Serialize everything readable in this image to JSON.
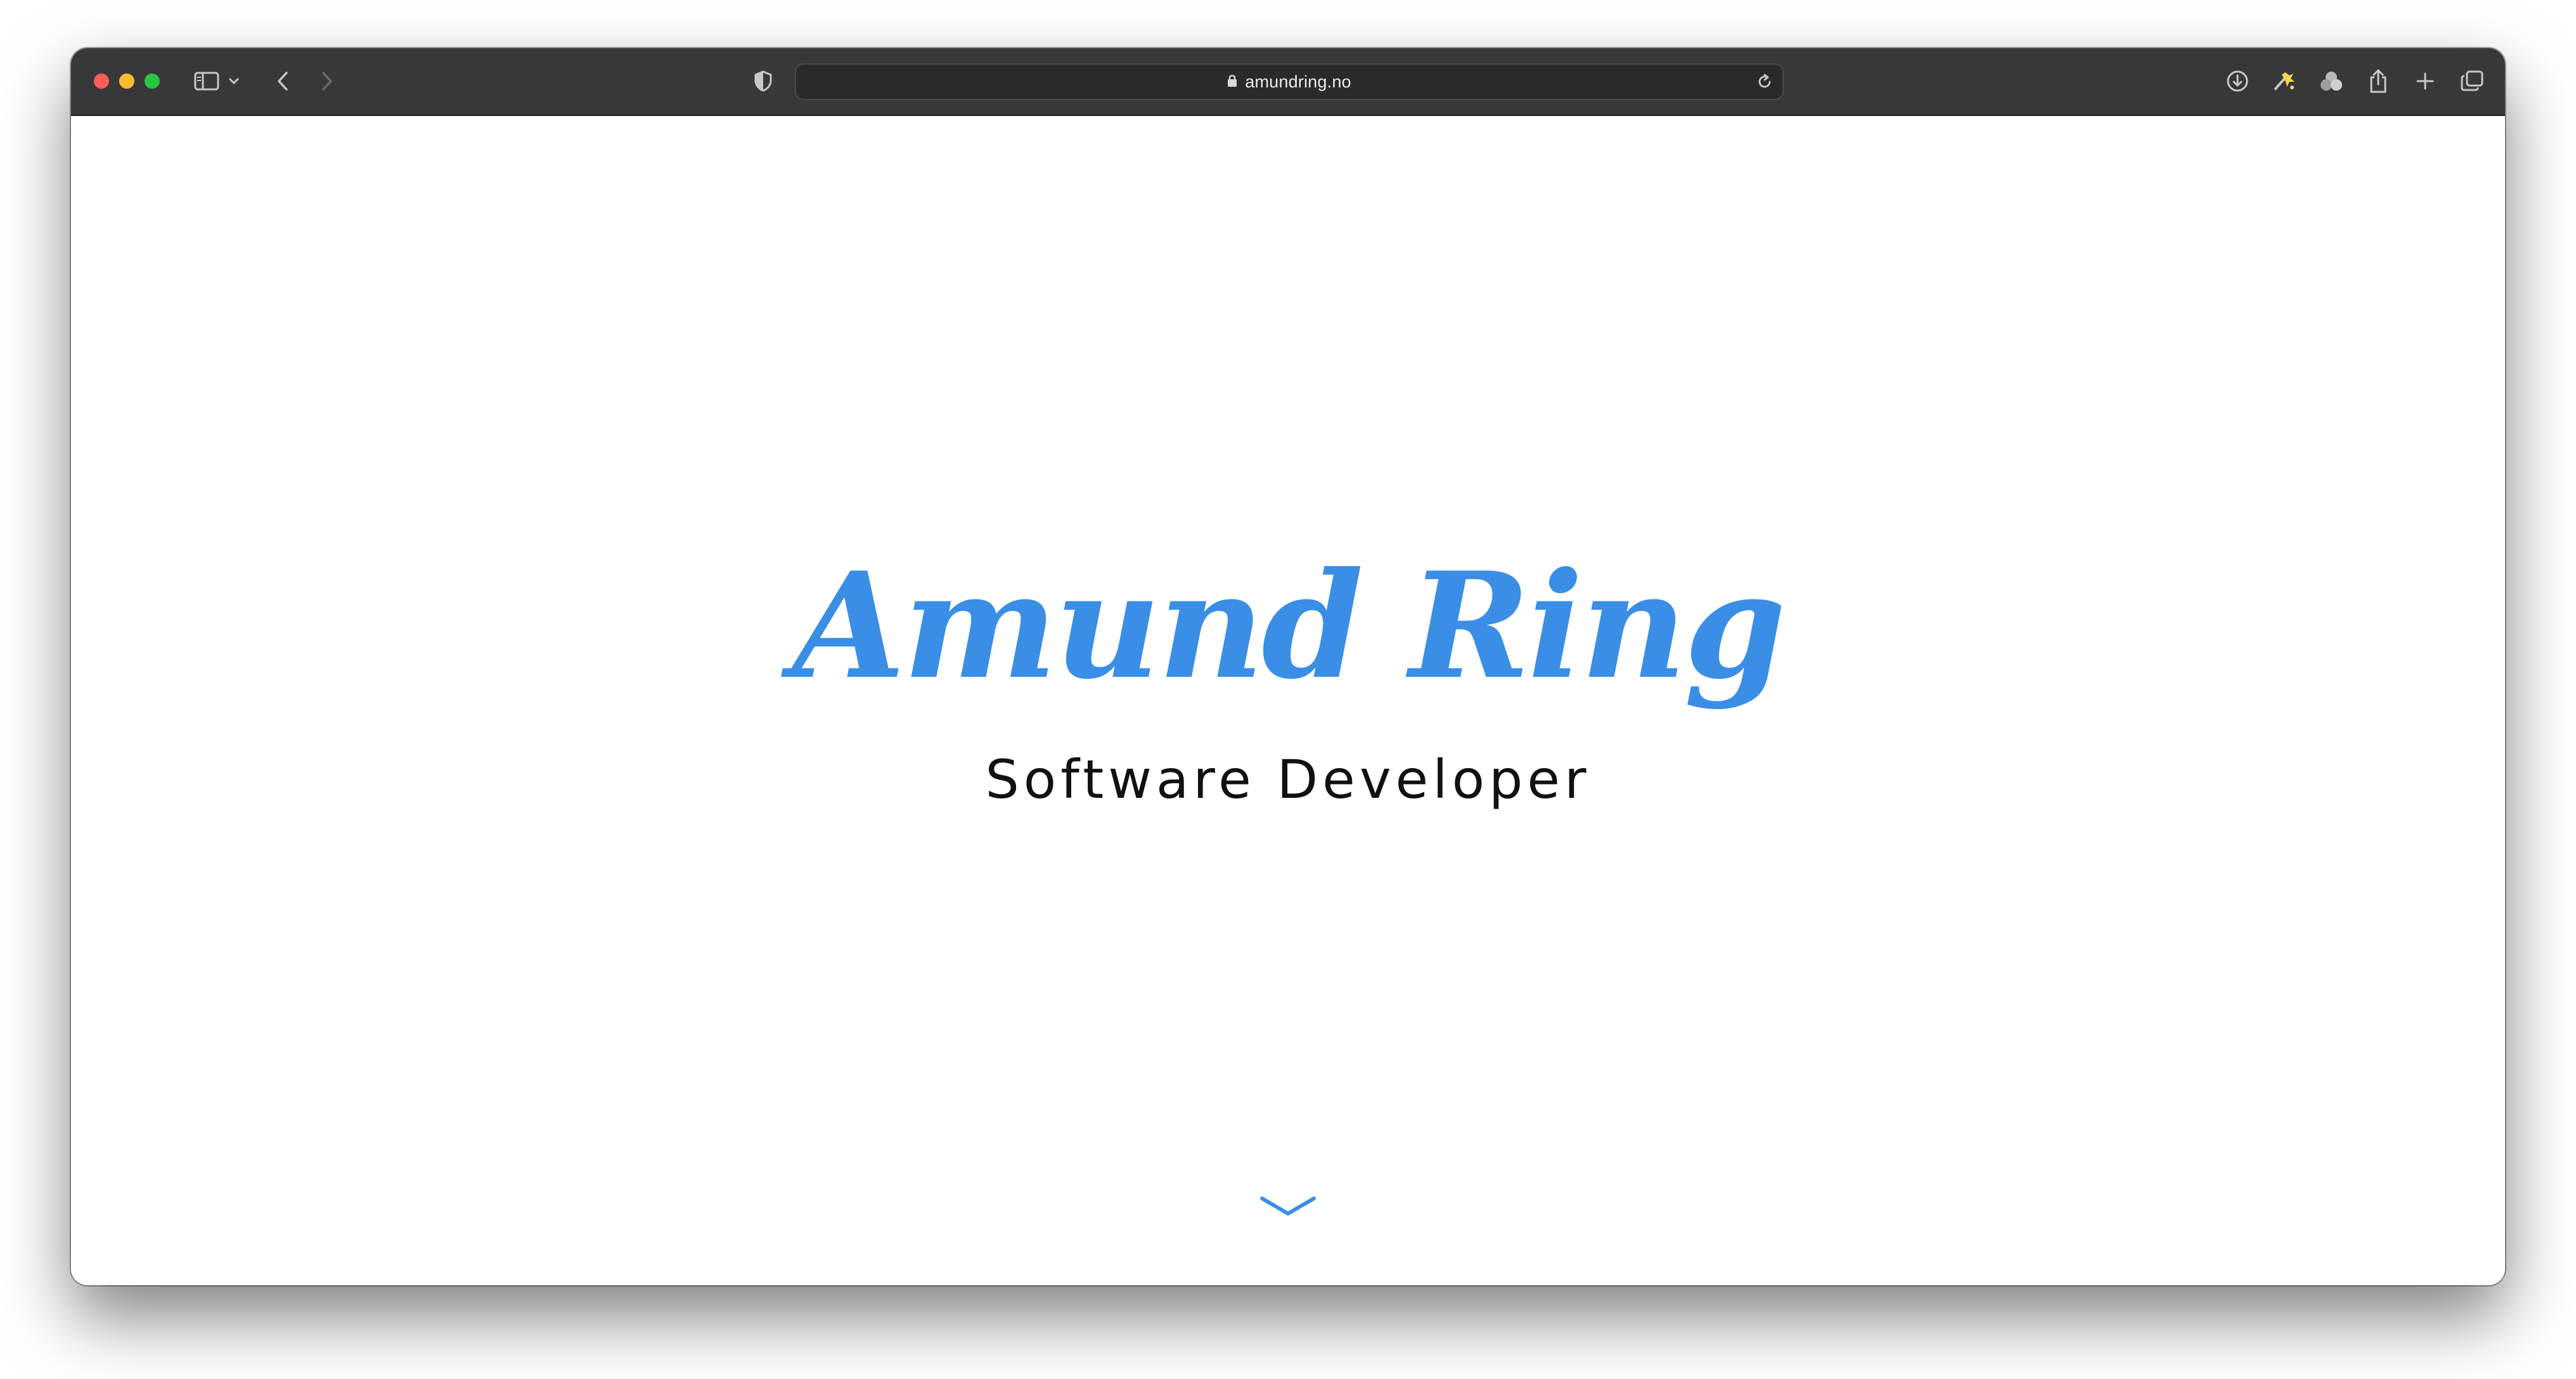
{
  "browser": {
    "address": "amundring.no",
    "colors": {
      "toolbar": "#38383a",
      "close": "#ff5f57",
      "minimize": "#febc2e",
      "zoom": "#28c840",
      "icon": "#c8c8c8"
    },
    "toolbar_icons": [
      "sidebar-icon",
      "chevron-down-icon",
      "back-icon",
      "forward-icon",
      "shield-icon",
      "lock-icon",
      "reload-icon",
      "download-icon",
      "extension-icon",
      "tab-group-icon",
      "share-icon",
      "new-tab-icon",
      "tab-overview-icon"
    ]
  },
  "page": {
    "name": "Amund Ring",
    "subtitle": "Software Developer",
    "accent_color": "#3a8ee6"
  }
}
